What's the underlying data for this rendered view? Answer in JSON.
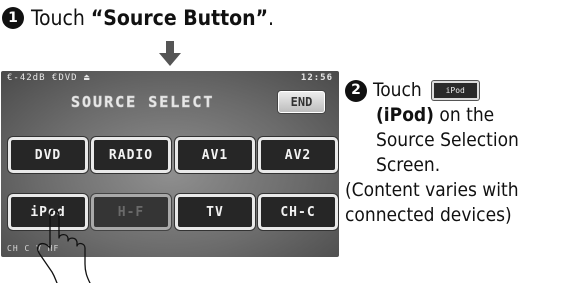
{
  "step1": {
    "number": "1",
    "prefix": "Touch ",
    "target": "“Source Button”",
    "suffix": "."
  },
  "screen": {
    "status_left": "€-42dB €DVD ⏏",
    "time": "12:56",
    "title": "SOURCE SELECT",
    "end_label": "END",
    "buttons": [
      {
        "label": "DVD",
        "state": "on"
      },
      {
        "label": "RADIO",
        "state": "on"
      },
      {
        "label": "AV1",
        "state": "on"
      },
      {
        "label": "AV2",
        "state": "on"
      },
      {
        "label": "iPod",
        "state": "on"
      },
      {
        "label": "H-F",
        "state": "dim"
      },
      {
        "label": "TV",
        "state": "on"
      },
      {
        "label": "CH-C",
        "state": "on"
      }
    ],
    "bottom_status": "CH C    V HF"
  },
  "step2": {
    "number": "2",
    "prefix": "Touch",
    "icon_label": "iPod",
    "target": "(iPod)",
    "rest1": " on the",
    "rest2": "Source Selection",
    "rest3": "Screen.",
    "note1": "(Content varies with",
    "note2": "connected devices)"
  }
}
